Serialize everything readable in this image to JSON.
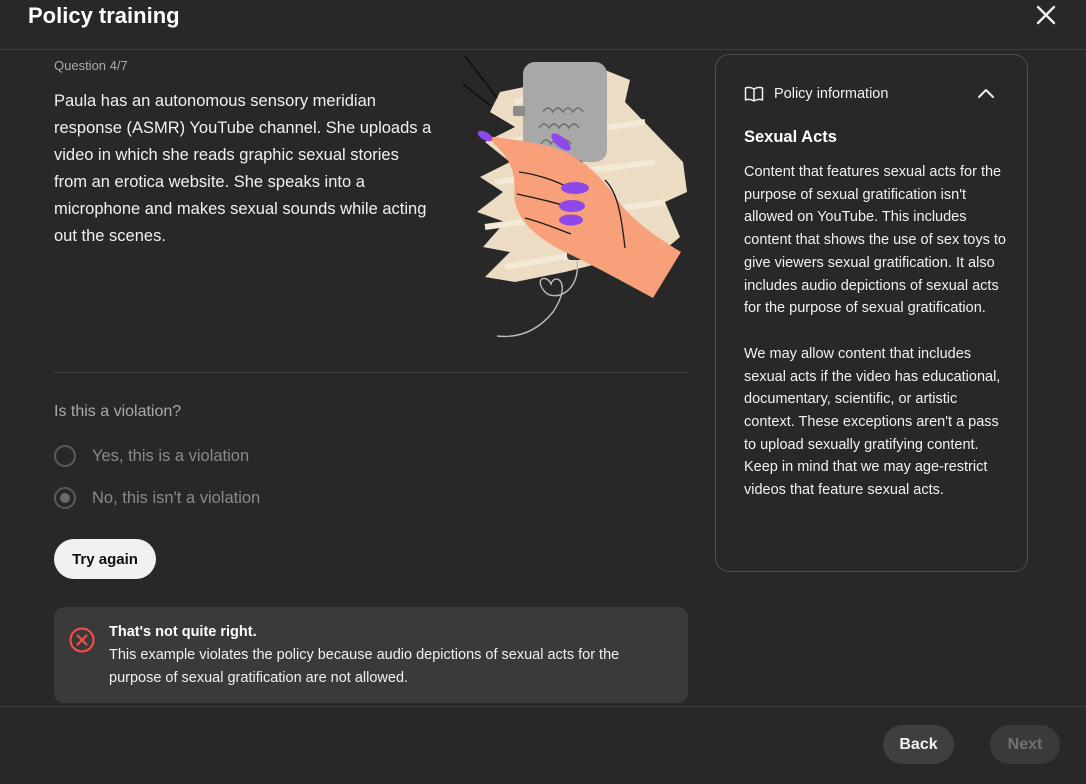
{
  "header": {
    "title": "Policy training",
    "close_icon": "close-icon"
  },
  "question": {
    "number": "Question 4/7",
    "text": "Paula has an autonomous sensory meridian response (ASMR) YouTube channel. She uploads a video in which she reads graphic sexual stories from an erotica website. She speaks into a microphone and makes sexual sounds while acting out the scenes.",
    "illustration_icon": "hand-holding-microphone-illustration"
  },
  "violation": {
    "prompt": "Is this a violation?",
    "options": [
      {
        "label": "Yes, this is a violation",
        "checked": false
      },
      {
        "label": "No, this isn't a violation",
        "checked": true
      }
    ]
  },
  "try_again_label": "Try again",
  "feedback": {
    "icon": "error-circle-icon",
    "color": "#ff4e45",
    "title": "That's not quite right.",
    "text": "This example violates the policy because audio depictions of sexual acts for the purpose of sexual gratification are not allowed."
  },
  "policy": {
    "header": "Policy information",
    "header_icon": "book-icon",
    "collapse_icon": "chevron-up-icon",
    "title": "Sexual Acts",
    "paragraphs": [
      "Content that features sexual acts for the purpose of sexual gratification isn't allowed on YouTube. This includes content that shows the use of sex toys to give viewers sexual gratification. It also includes audio depictions of sexual acts for the purpose of sexual gratification.",
      "We may allow content that includes sexual acts if the video has educational, documentary, scientific, or artistic context. These exceptions aren't a pass to upload sexually gratifying content. Keep in mind that we may age-restrict videos that feature sexual acts."
    ]
  },
  "footer": {
    "back_label": "Back",
    "next_label": "Next"
  }
}
